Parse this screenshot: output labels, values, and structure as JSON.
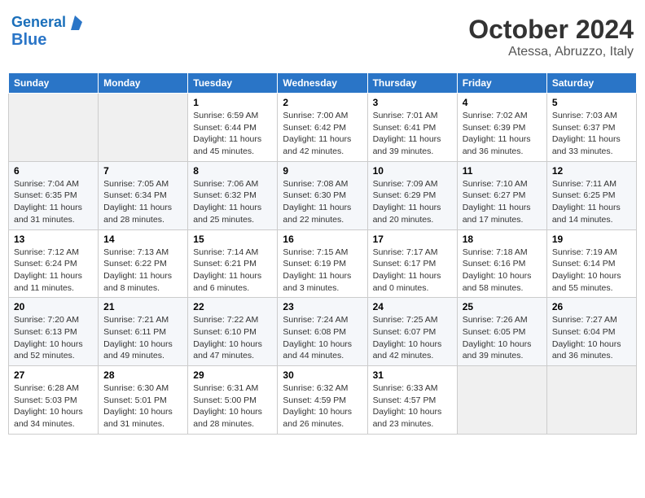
{
  "header": {
    "logo_line1": "General",
    "logo_line2": "Blue",
    "month": "October 2024",
    "location": "Atessa, Abruzzo, Italy"
  },
  "weekdays": [
    "Sunday",
    "Monday",
    "Tuesday",
    "Wednesday",
    "Thursday",
    "Friday",
    "Saturday"
  ],
  "weeks": [
    [
      {
        "day": "",
        "info": ""
      },
      {
        "day": "",
        "info": ""
      },
      {
        "day": "1",
        "info": "Sunrise: 6:59 AM\nSunset: 6:44 PM\nDaylight: 11 hours\nand 45 minutes."
      },
      {
        "day": "2",
        "info": "Sunrise: 7:00 AM\nSunset: 6:42 PM\nDaylight: 11 hours\nand 42 minutes."
      },
      {
        "day": "3",
        "info": "Sunrise: 7:01 AM\nSunset: 6:41 PM\nDaylight: 11 hours\nand 39 minutes."
      },
      {
        "day": "4",
        "info": "Sunrise: 7:02 AM\nSunset: 6:39 PM\nDaylight: 11 hours\nand 36 minutes."
      },
      {
        "day": "5",
        "info": "Sunrise: 7:03 AM\nSunset: 6:37 PM\nDaylight: 11 hours\nand 33 minutes."
      }
    ],
    [
      {
        "day": "6",
        "info": "Sunrise: 7:04 AM\nSunset: 6:35 PM\nDaylight: 11 hours\nand 31 minutes."
      },
      {
        "day": "7",
        "info": "Sunrise: 7:05 AM\nSunset: 6:34 PM\nDaylight: 11 hours\nand 28 minutes."
      },
      {
        "day": "8",
        "info": "Sunrise: 7:06 AM\nSunset: 6:32 PM\nDaylight: 11 hours\nand 25 minutes."
      },
      {
        "day": "9",
        "info": "Sunrise: 7:08 AM\nSunset: 6:30 PM\nDaylight: 11 hours\nand 22 minutes."
      },
      {
        "day": "10",
        "info": "Sunrise: 7:09 AM\nSunset: 6:29 PM\nDaylight: 11 hours\nand 20 minutes."
      },
      {
        "day": "11",
        "info": "Sunrise: 7:10 AM\nSunset: 6:27 PM\nDaylight: 11 hours\nand 17 minutes."
      },
      {
        "day": "12",
        "info": "Sunrise: 7:11 AM\nSunset: 6:25 PM\nDaylight: 11 hours\nand 14 minutes."
      }
    ],
    [
      {
        "day": "13",
        "info": "Sunrise: 7:12 AM\nSunset: 6:24 PM\nDaylight: 11 hours\nand 11 minutes."
      },
      {
        "day": "14",
        "info": "Sunrise: 7:13 AM\nSunset: 6:22 PM\nDaylight: 11 hours\nand 8 minutes."
      },
      {
        "day": "15",
        "info": "Sunrise: 7:14 AM\nSunset: 6:21 PM\nDaylight: 11 hours\nand 6 minutes."
      },
      {
        "day": "16",
        "info": "Sunrise: 7:15 AM\nSunset: 6:19 PM\nDaylight: 11 hours\nand 3 minutes."
      },
      {
        "day": "17",
        "info": "Sunrise: 7:17 AM\nSunset: 6:17 PM\nDaylight: 11 hours\nand 0 minutes."
      },
      {
        "day": "18",
        "info": "Sunrise: 7:18 AM\nSunset: 6:16 PM\nDaylight: 10 hours\nand 58 minutes."
      },
      {
        "day": "19",
        "info": "Sunrise: 7:19 AM\nSunset: 6:14 PM\nDaylight: 10 hours\nand 55 minutes."
      }
    ],
    [
      {
        "day": "20",
        "info": "Sunrise: 7:20 AM\nSunset: 6:13 PM\nDaylight: 10 hours\nand 52 minutes."
      },
      {
        "day": "21",
        "info": "Sunrise: 7:21 AM\nSunset: 6:11 PM\nDaylight: 10 hours\nand 49 minutes."
      },
      {
        "day": "22",
        "info": "Sunrise: 7:22 AM\nSunset: 6:10 PM\nDaylight: 10 hours\nand 47 minutes."
      },
      {
        "day": "23",
        "info": "Sunrise: 7:24 AM\nSunset: 6:08 PM\nDaylight: 10 hours\nand 44 minutes."
      },
      {
        "day": "24",
        "info": "Sunrise: 7:25 AM\nSunset: 6:07 PM\nDaylight: 10 hours\nand 42 minutes."
      },
      {
        "day": "25",
        "info": "Sunrise: 7:26 AM\nSunset: 6:05 PM\nDaylight: 10 hours\nand 39 minutes."
      },
      {
        "day": "26",
        "info": "Sunrise: 7:27 AM\nSunset: 6:04 PM\nDaylight: 10 hours\nand 36 minutes."
      }
    ],
    [
      {
        "day": "27",
        "info": "Sunrise: 6:28 AM\nSunset: 5:03 PM\nDaylight: 10 hours\nand 34 minutes."
      },
      {
        "day": "28",
        "info": "Sunrise: 6:30 AM\nSunset: 5:01 PM\nDaylight: 10 hours\nand 31 minutes."
      },
      {
        "day": "29",
        "info": "Sunrise: 6:31 AM\nSunset: 5:00 PM\nDaylight: 10 hours\nand 28 minutes."
      },
      {
        "day": "30",
        "info": "Sunrise: 6:32 AM\nSunset: 4:59 PM\nDaylight: 10 hours\nand 26 minutes."
      },
      {
        "day": "31",
        "info": "Sunrise: 6:33 AM\nSunset: 4:57 PM\nDaylight: 10 hours\nand 23 minutes."
      },
      {
        "day": "",
        "info": ""
      },
      {
        "day": "",
        "info": ""
      }
    ]
  ]
}
